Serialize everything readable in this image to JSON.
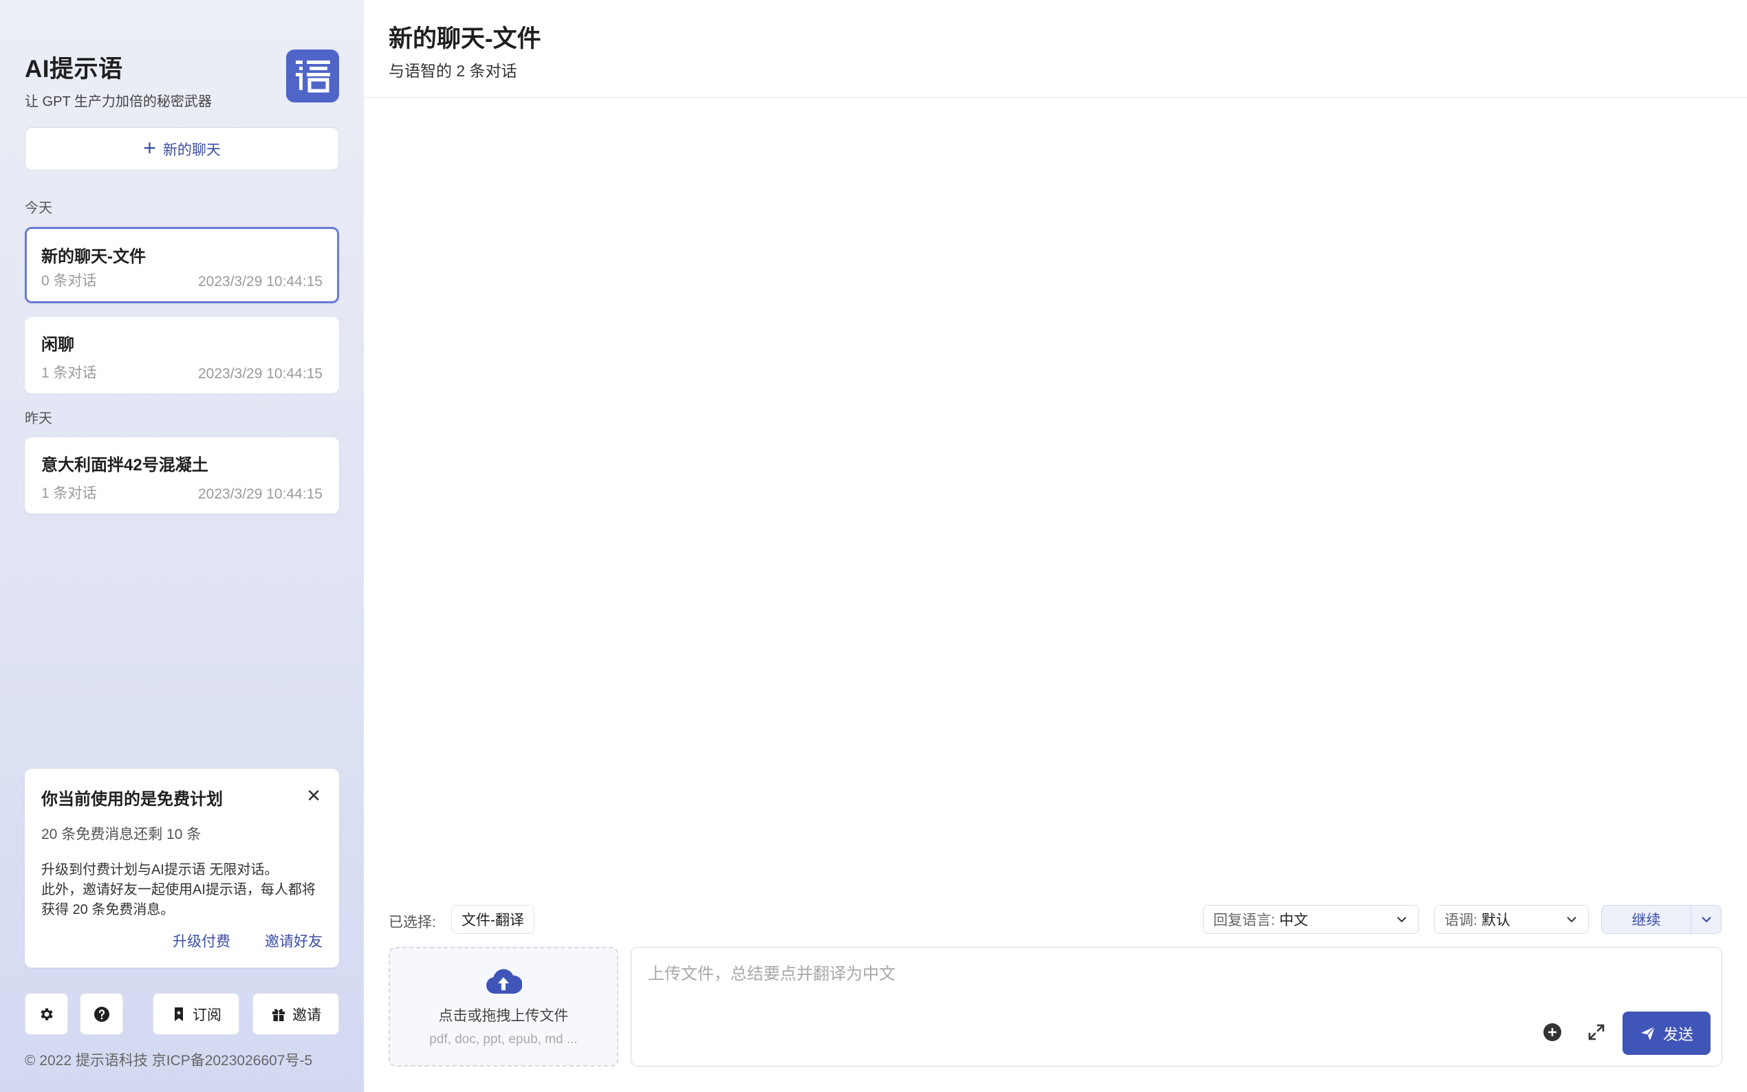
{
  "brand": {
    "title": "AI提示语",
    "subtitle": "让 GPT 生产力加倍的秘密武器"
  },
  "sidebar": {
    "new_chat_label": "新的聊天",
    "groups": [
      {
        "label": "今天",
        "chats": [
          {
            "title": "新的聊天-文件",
            "count": "0 条对话",
            "time": "2023/3/29 10:44:15",
            "active": true
          },
          {
            "title": "闲聊",
            "count": "1 条对话",
            "time": "2023/3/29 10:44:15",
            "active": false
          }
        ]
      },
      {
        "label": "昨天",
        "chats": [
          {
            "title": "意大利面拌42号混凝土",
            "count": "1 条对话",
            "time": "2023/3/29 10:44:15",
            "active": false
          }
        ]
      }
    ],
    "plan": {
      "title": "你当前使用的是免费计划",
      "quota": "20 条免费消息还剩 10 条",
      "desc_line1": "升级到付费计划与AI提示语 无限对话。",
      "desc_line2": "此外，邀请好友一起使用AI提示语，每人都将获得 20 条免费消息。",
      "upgrade_label": "升级付费",
      "invite_friends_label": "邀请好友"
    },
    "footer": {
      "subscribe_label": "订阅",
      "invite_label": "邀请",
      "copyright": "© 2022 提示语科技 京ICP备2023026607号-5"
    }
  },
  "main": {
    "title": "新的聊天-文件",
    "subtitle": "与语智的 2 条对话",
    "selected_label": "已选择:",
    "selected_tag": "文件-翻译",
    "reply_language": {
      "label": "回复语言:",
      "value": "中文"
    },
    "tone": {
      "label": "语调:",
      "value": "默认"
    },
    "continue_label": "继续",
    "upload": {
      "title": "点击或拖拽上传文件",
      "hint": "pdf, doc, ppt, epub, md ..."
    },
    "input_placeholder": "上传文件，总结要点并翻译为中文",
    "send_label": "发送"
  },
  "colors": {
    "accent": "#4055b8",
    "active_border": "#6a7bd4",
    "logo_bg": "#5065c8"
  }
}
